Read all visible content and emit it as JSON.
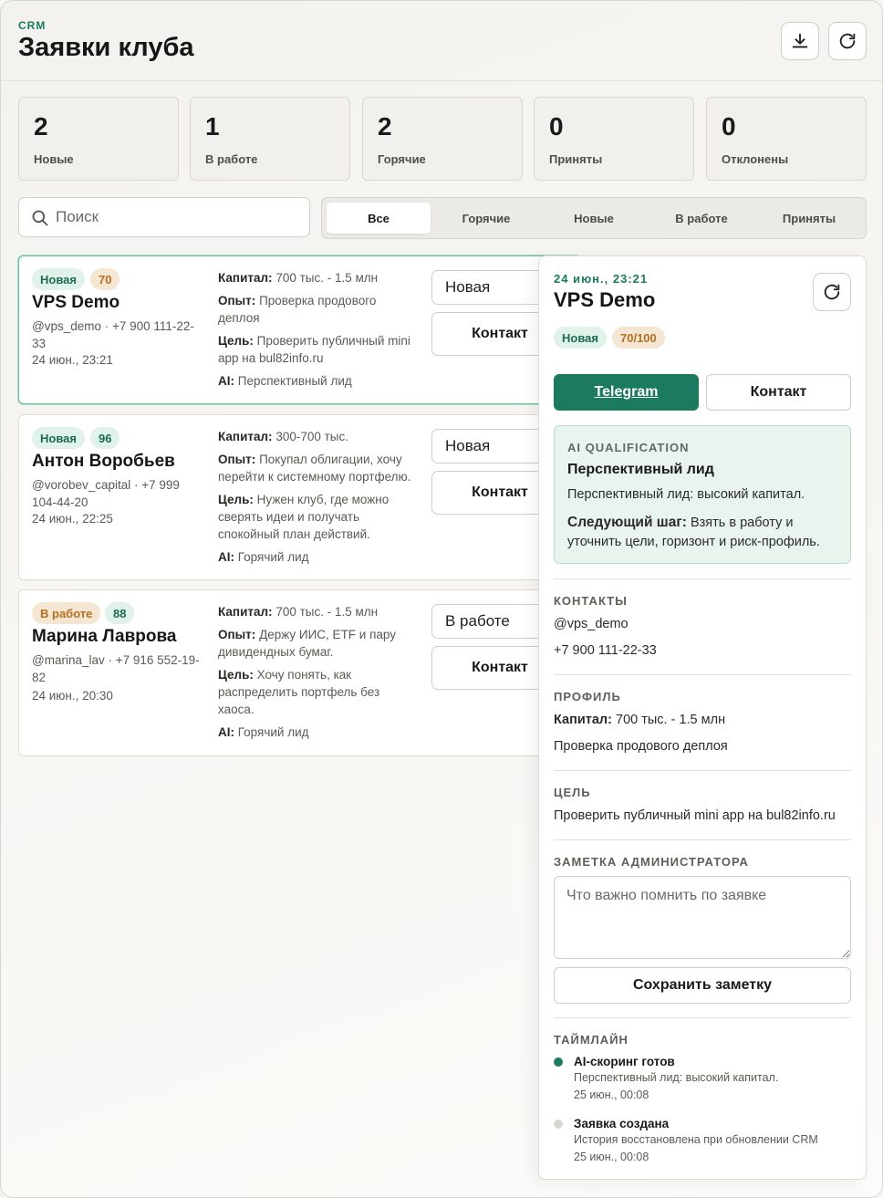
{
  "header": {
    "eyebrow": "CRM",
    "title": "Заявки клуба",
    "export_icon": "download-icon",
    "refresh_icon": "refresh-icon"
  },
  "stats": [
    {
      "value": "2",
      "label": "Новые"
    },
    {
      "value": "1",
      "label": "В работе"
    },
    {
      "value": "2",
      "label": "Горячие"
    },
    {
      "value": "0",
      "label": "Приняты"
    },
    {
      "value": "0",
      "label": "Отклонены"
    }
  ],
  "search": {
    "placeholder": "Поиск",
    "value": ""
  },
  "tabs": [
    {
      "label": "Все",
      "active": true
    },
    {
      "label": "Горячие",
      "active": false
    },
    {
      "label": "Новые",
      "active": false
    },
    {
      "label": "В работе",
      "active": false
    },
    {
      "label": "Приняты",
      "active": false
    }
  ],
  "leads": [
    {
      "status_badge": "Новая",
      "score": "70",
      "name": "VPS Demo",
      "contact": "@vps_demo · +7 900 111-22-33",
      "date": "24 июн., 23:21",
      "capital_label": "Капитал:",
      "capital": "700 тыс. - 1.5 млн",
      "experience_label": "Опыт:",
      "experience": "Проверка продового деплоя",
      "goal_label": "Цель:",
      "goal": "Проверить публичный mini app на bul82info.ru",
      "ai_label": "AI:",
      "ai": "Перспективный лид",
      "status_select": "Новая",
      "contact_button": "Контакт"
    },
    {
      "status_badge": "Новая",
      "score": "96",
      "name": "Антон Воробьев",
      "contact": "@vorobev_capital · +7 999 104-44-20",
      "date": "24 июн., 22:25",
      "capital_label": "Капитал:",
      "capital": "300-700 тыс.",
      "experience_label": "Опыт:",
      "experience": "Покупал облигации, хочу перейти к системному портфелю.",
      "goal_label": "Цель:",
      "goal": "Нужен клуб, где можно сверять идеи и получать спокойный план действий.",
      "ai_label": "AI:",
      "ai": "Горячий лид",
      "status_select": "Новая",
      "contact_button": "Контакт"
    },
    {
      "status_badge": "В работе",
      "score": "88",
      "name": "Марина Лаврова",
      "contact": "@marina_lav · +7 916 552-19-82",
      "date": "24 июн., 20:30",
      "capital_label": "Капитал:",
      "capital": "700 тыс. - 1.5 млн",
      "experience_label": "Опыт:",
      "experience": "Держу ИИС, ETF и пару дивидендных бумаг.",
      "goal_label": "Цель:",
      "goal": "Хочу понять, как распределить портфель без хаоса.",
      "ai_label": "AI:",
      "ai": "Горячий лид",
      "status_select": "В работе",
      "contact_button": "Контакт"
    }
  ],
  "detail": {
    "date": "24 июн., 23:21",
    "name": "VPS Demo",
    "status_badge": "Новая",
    "score": "70/100",
    "telegram_button": "Telegram",
    "contact_button": "Контакт",
    "ai": {
      "heading": "AI QUALIFICATION",
      "verdict": "Перспективный лид",
      "summary": "Перспективный лид: высокий капитал.",
      "next_step_label": "Следующий шаг:",
      "next_step": "Взять в работу и уточнить цели, горизонт и риск-профиль."
    },
    "contacts": {
      "heading": "КОНТАКТЫ",
      "username": "@vps_demo",
      "phone": "+7 900 111-22-33"
    },
    "profile": {
      "heading": "ПРОФИЛЬ",
      "capital_label": "Капитал:",
      "capital": "700 тыс. - 1.5 млн",
      "experience": "Проверка продового деплоя"
    },
    "goal": {
      "heading": "ЦЕЛЬ",
      "text": "Проверить публичный mini app на bul82info.ru"
    },
    "note": {
      "heading": "ЗАМЕТКА АДМИНИСТРАТОРА",
      "placeholder": "Что важно помнить по заявке",
      "value": "",
      "save_button": "Сохранить заметку"
    },
    "timeline": {
      "heading": "ТАЙМЛАЙН",
      "events": [
        {
          "title": "AI-скоринг готов",
          "description": "Перспективный лид: высокий капитал.",
          "date": "25 июн., 00:08",
          "dot_color": "#1b7a5f"
        },
        {
          "title": "Заявка создана",
          "description": "История восстановлена при обновлении CRM",
          "date": "25 июн., 00:08",
          "dot_color": "#d6d5d0"
        }
      ]
    }
  },
  "colors": {
    "accent": "#1b7a5f",
    "badge_new_bg": "#e0f2ea",
    "badge_work_bg": "#f4e6d2",
    "badge_work_text": "#b3701e"
  }
}
